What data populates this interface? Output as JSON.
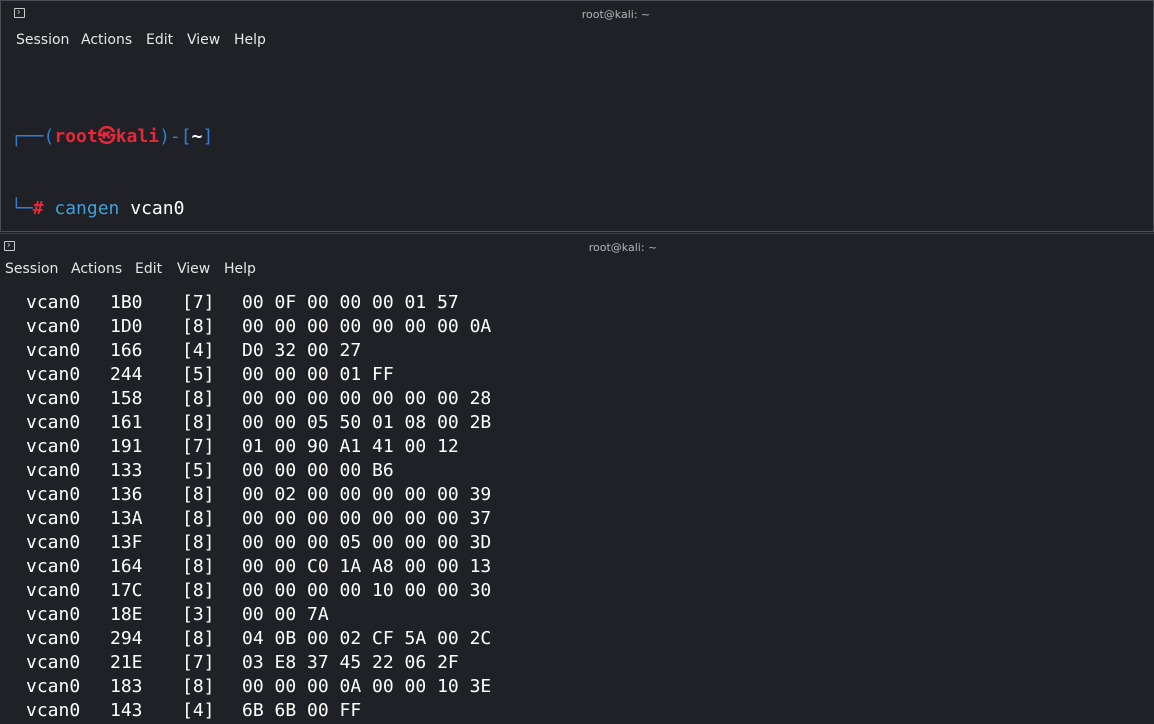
{
  "top_window": {
    "title": "root@kali: ~",
    "menu": [
      "Session",
      "Actions",
      "Edit",
      "View",
      "Help"
    ],
    "prompt": {
      "bracket_open": "┌──(",
      "user": "root",
      "at": "㉿",
      "host": "kali",
      "bracket_mid": ")-[",
      "dir": "~",
      "bracket_close": "]",
      "corner": "└─",
      "hash": "#",
      "command": "cangen",
      "argument": "vcan0"
    }
  },
  "bottom_window": {
    "title": "root@kali: ~",
    "menu": [
      "Session",
      "Actions",
      "Edit",
      "View",
      "Help"
    ],
    "frames": [
      {
        "iface": "vcan0",
        "id": "1B0",
        "dlc": "[7]",
        "data": "00 0F 00 00 00 01 57"
      },
      {
        "iface": "vcan0",
        "id": "1D0",
        "dlc": "[8]",
        "data": "00 00 00 00 00 00 00 0A"
      },
      {
        "iface": "vcan0",
        "id": "166",
        "dlc": "[4]",
        "data": "D0 32 00 27"
      },
      {
        "iface": "vcan0",
        "id": "244",
        "dlc": "[5]",
        "data": "00 00 00 01 FF"
      },
      {
        "iface": "vcan0",
        "id": "158",
        "dlc": "[8]",
        "data": "00 00 00 00 00 00 00 28"
      },
      {
        "iface": "vcan0",
        "id": "161",
        "dlc": "[8]",
        "data": "00 00 05 50 01 08 00 2B"
      },
      {
        "iface": "vcan0",
        "id": "191",
        "dlc": "[7]",
        "data": "01 00 90 A1 41 00 12"
      },
      {
        "iface": "vcan0",
        "id": "133",
        "dlc": "[5]",
        "data": "00 00 00 00 B6"
      },
      {
        "iface": "vcan0",
        "id": "136",
        "dlc": "[8]",
        "data": "00 02 00 00 00 00 00 39"
      },
      {
        "iface": "vcan0",
        "id": "13A",
        "dlc": "[8]",
        "data": "00 00 00 00 00 00 00 37"
      },
      {
        "iface": "vcan0",
        "id": "13F",
        "dlc": "[8]",
        "data": "00 00 00 05 00 00 00 3D"
      },
      {
        "iface": "vcan0",
        "id": "164",
        "dlc": "[8]",
        "data": "00 00 C0 1A A8 00 00 13"
      },
      {
        "iface": "vcan0",
        "id": "17C",
        "dlc": "[8]",
        "data": "00 00 00 00 10 00 00 30"
      },
      {
        "iface": "vcan0",
        "id": "18E",
        "dlc": "[3]",
        "data": "00 00 7A"
      },
      {
        "iface": "vcan0",
        "id": "294",
        "dlc": "[8]",
        "data": "04 0B 00 02 CF 5A 00 2C"
      },
      {
        "iface": "vcan0",
        "id": "21E",
        "dlc": "[7]",
        "data": "03 E8 37 45 22 06 2F"
      },
      {
        "iface": "vcan0",
        "id": "183",
        "dlc": "[8]",
        "data": "00 00 00 0A 00 00 10 3E"
      },
      {
        "iface": "vcan0",
        "id": "143",
        "dlc": "[4]",
        "data": "6B 6B 00 FF"
      }
    ]
  },
  "colors": {
    "background": "#1f2126",
    "prompt_frame": "#2f7ed8",
    "prompt_user": "#e5283a",
    "command": "#3ea0d9",
    "text": "#ffffff"
  }
}
